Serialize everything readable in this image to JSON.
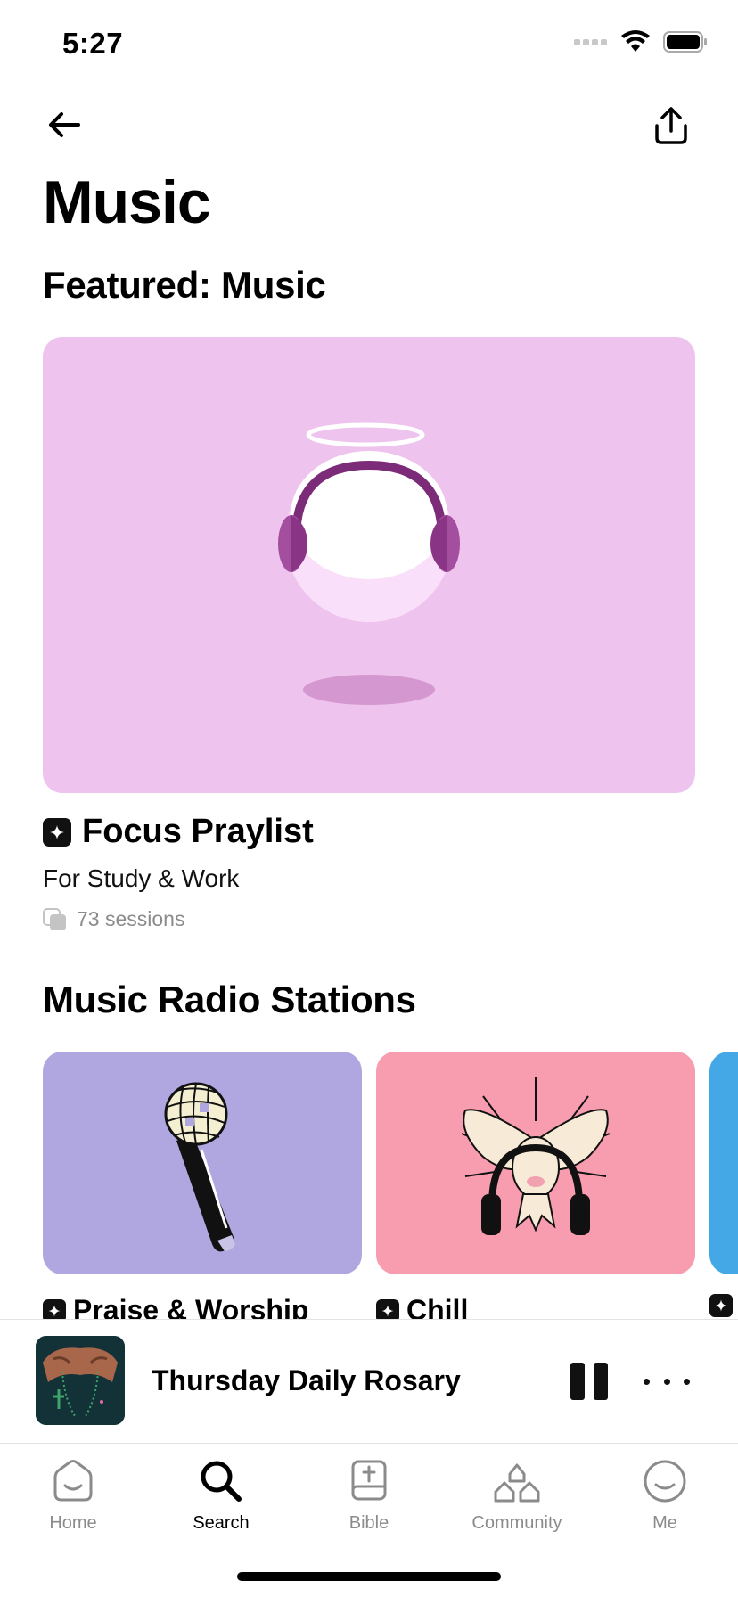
{
  "status_bar": {
    "time": "5:27"
  },
  "page": {
    "title": "Music"
  },
  "featured": {
    "section_title": "Featured: Music",
    "title": "Focus Praylist",
    "subtitle": "For Study & Work",
    "sessions": "73 sessions",
    "card_color": "#eec3ee"
  },
  "radio": {
    "section_title": "Music Radio Stations",
    "stations": [
      {
        "label": "Praise & Worship",
        "color": "#b0a7e0"
      },
      {
        "label": "Chill",
        "color": "#f79daf"
      },
      {
        "label": "",
        "color": "#45a8e6"
      }
    ]
  },
  "mini_player": {
    "title": "Thursday Daily Rosary"
  },
  "tabs": [
    {
      "label": "Home",
      "icon": "home-smile-icon"
    },
    {
      "label": "Search",
      "icon": "search-icon",
      "active": true
    },
    {
      "label": "Bible",
      "icon": "bible-icon"
    },
    {
      "label": "Community",
      "icon": "community-icon"
    },
    {
      "label": "Me",
      "icon": "profile-smile-icon"
    }
  ]
}
